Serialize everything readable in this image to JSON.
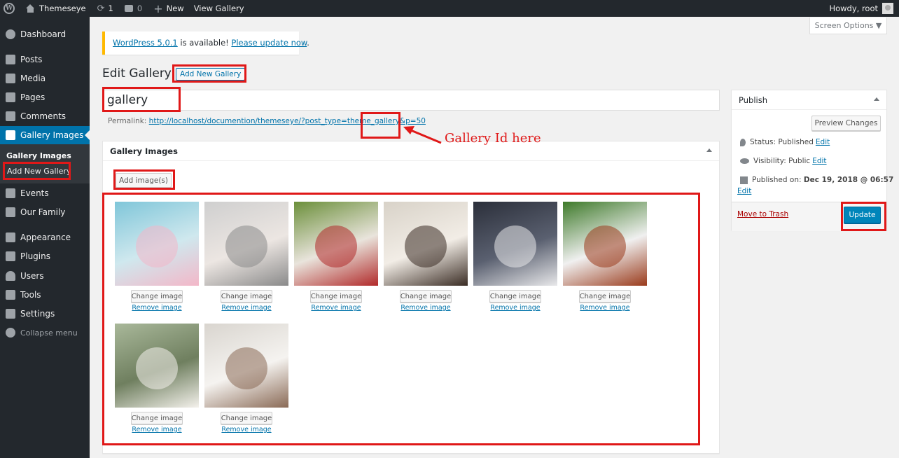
{
  "admin_bar": {
    "site_name": "Themeseye",
    "updates_count": "1",
    "comments_count": "0",
    "new_label": "New",
    "view_label": "View Gallery",
    "howdy": "Howdy, root"
  },
  "sidebar": {
    "items": [
      {
        "label": "Dashboard",
        "icon": "dashboard-icon"
      },
      {
        "label": "Posts",
        "icon": "pin-icon"
      },
      {
        "label": "Media",
        "icon": "media-icon"
      },
      {
        "label": "Pages",
        "icon": "pages-icon"
      },
      {
        "label": "Comments",
        "icon": "comment-icon"
      },
      {
        "label": "Gallery Images",
        "icon": "gallery-icon"
      },
      {
        "label": "Events",
        "icon": "tag-icon"
      },
      {
        "label": "Our Family",
        "icon": "graduation-cap-icon"
      },
      {
        "label": "Appearance",
        "icon": "paintbrush-icon"
      },
      {
        "label": "Plugins",
        "icon": "plugin-icon"
      },
      {
        "label": "Users",
        "icon": "user-icon"
      },
      {
        "label": "Tools",
        "icon": "wrench-icon"
      },
      {
        "label": "Settings",
        "icon": "settings-icon"
      }
    ],
    "submenu": [
      "Gallery Images",
      "Add New Gallery"
    ],
    "collapse_label": "Collapse menu"
  },
  "notice": {
    "version_link": "WordPress 5.0.1",
    "middle_text": " is available! ",
    "update_link": "Please update now",
    "end_text": "."
  },
  "screen_options": "Screen Options ▼",
  "page": {
    "title": "Edit Gallery",
    "add_new_label": "Add New Gallery",
    "post_title": "gallery",
    "permalink_label": "Permalink:",
    "permalink_url": "http://localhost/documention/themeseye/?post_type=theme_gallery&p=50"
  },
  "annotation": "Gallery Id here",
  "gallery_box": {
    "title": "Gallery Images",
    "add_images_label": "Add image(s)",
    "change_label": "Change image",
    "remove_label": "Remove image",
    "image_count": 8
  },
  "publish": {
    "title": "Publish",
    "preview_label": "Preview Changes",
    "status_label": "Status:",
    "status_value": "Published",
    "visibility_label": "Visibility:",
    "visibility_value": "Public",
    "published_label": "Published on:",
    "published_value": "Dec 19, 2018 @ 06:57",
    "edit_label": "Edit",
    "trash_label": "Move to Trash",
    "update_label": "Update"
  },
  "colors": {
    "accent": "#0073aa",
    "annotation": "#e01818",
    "notice": "#ffb900"
  }
}
